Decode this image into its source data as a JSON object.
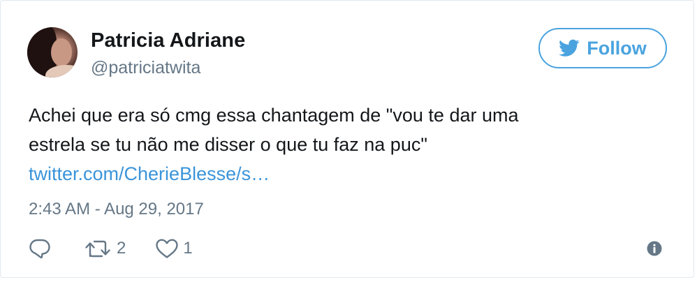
{
  "user": {
    "name": "Patricia Adriane",
    "handle": "@patriciatwita"
  },
  "follow_button": {
    "label": "Follow",
    "icon": "twitter-bird-icon"
  },
  "tweet": {
    "text_lines": [
      "Achei que era só cmg essa chantagem de \"vou te dar uma",
      "estrela se tu não me disser o que tu faz na puc\""
    ],
    "link": "twitter.com/CherieBlesse/s…",
    "timestamp": "2:43 AM - Aug 29, 2017"
  },
  "actions": {
    "reply": {
      "icon": "reply-icon"
    },
    "retweet": {
      "icon": "retweet-icon",
      "count": "2"
    },
    "like": {
      "icon": "heart-icon",
      "count": "1"
    },
    "info": {
      "icon": "info-icon"
    }
  },
  "colors": {
    "accent": "#4aa3df",
    "link": "#3b94d9",
    "secondary_text": "#657786",
    "border": "#e1e8ed"
  }
}
